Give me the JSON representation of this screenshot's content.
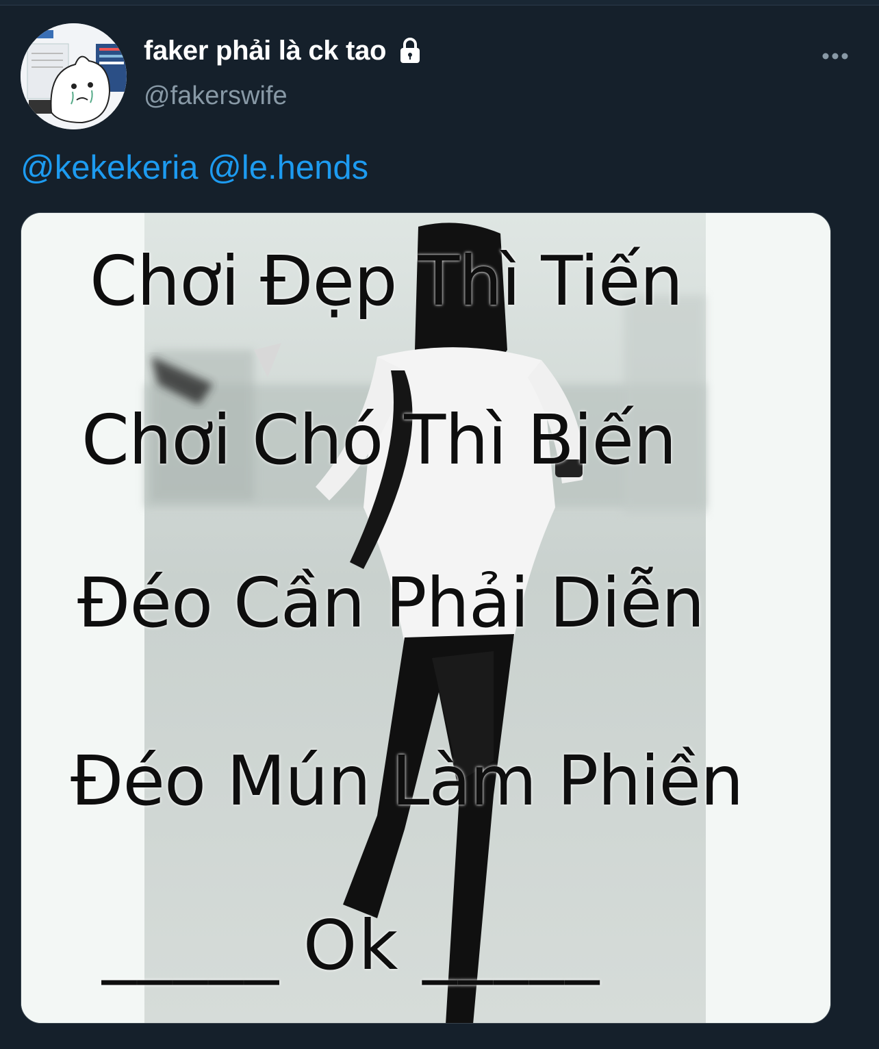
{
  "user": {
    "display_name": "faker phải là ck tao",
    "handle": "@fakerswife",
    "protected_icon": "lock-icon",
    "avatar": "avatar-cartoon"
  },
  "tweet": {
    "mentions": [
      "@kekekeria",
      "@le.hends"
    ]
  },
  "media": {
    "lines": [
      "Chơi Đẹp Thì Tiến",
      "Chơi Chó Thì Biến",
      "Đéo Cần Phải Diễn",
      "Đéo Mún Làm Phiền",
      "_____ Ok _____"
    ]
  },
  "colors": {
    "background": "#15202b",
    "link": "#1d9bf0",
    "secondary_text": "#8899a6"
  }
}
